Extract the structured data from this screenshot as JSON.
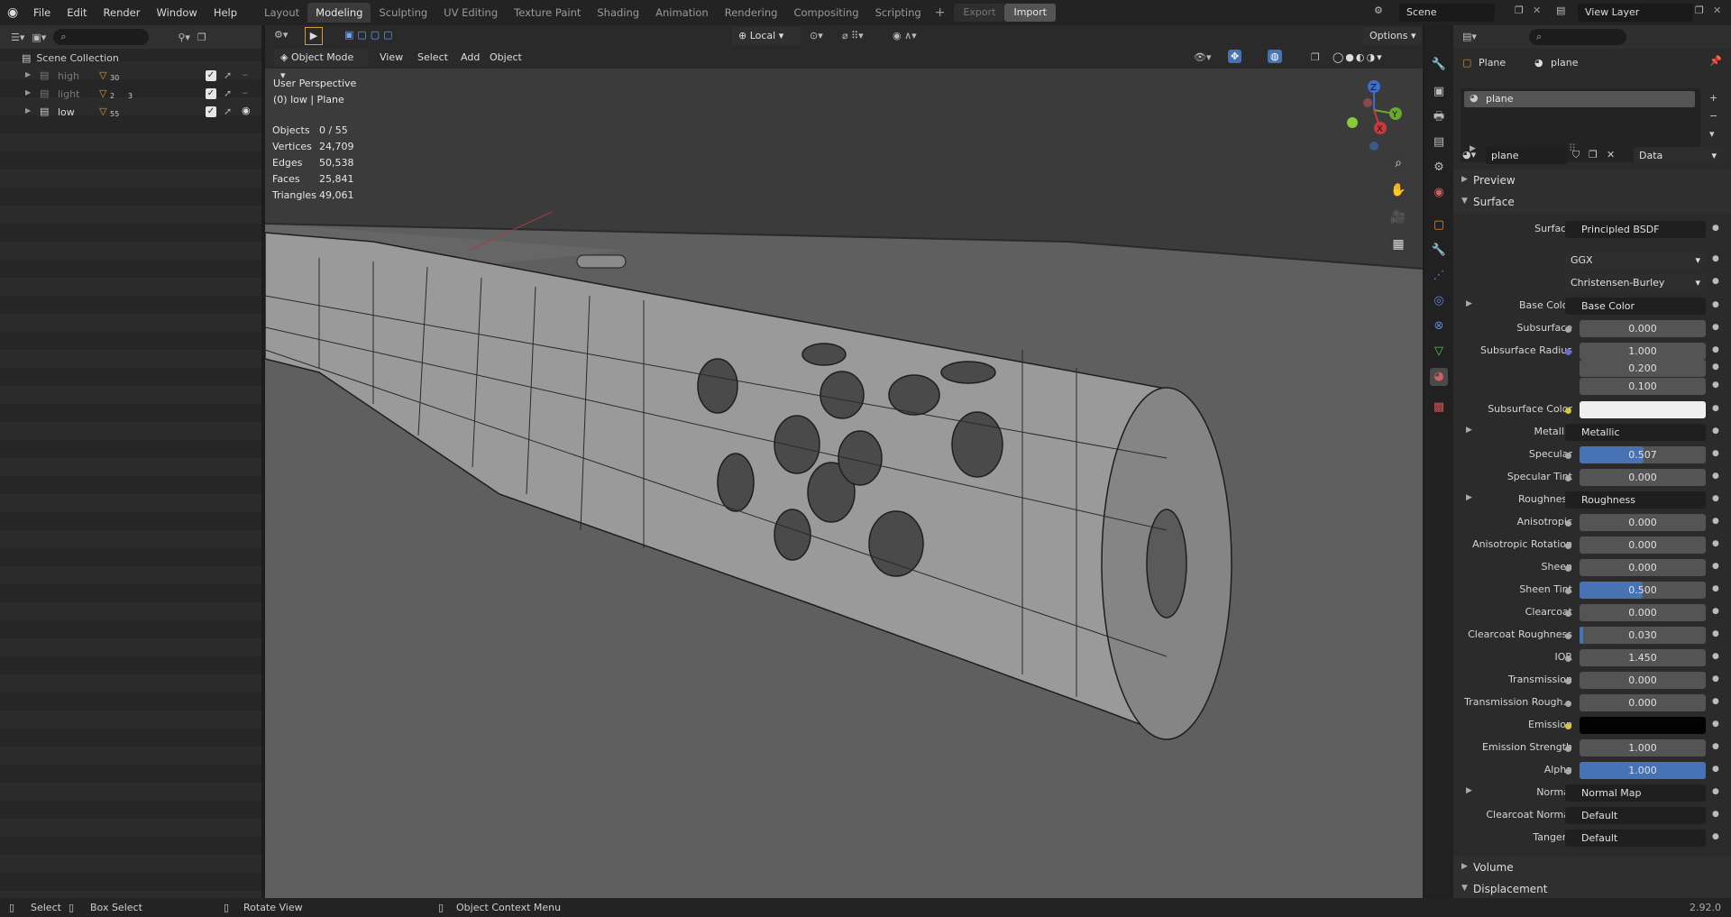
{
  "topbar": {
    "menu": [
      "File",
      "Edit",
      "Render",
      "Window",
      "Help"
    ],
    "workspaces": [
      "Layout",
      "Modeling",
      "Sculpting",
      "UV Editing",
      "Texture Paint",
      "Shading",
      "Animation",
      "Rendering",
      "Compositing",
      "Scripting"
    ],
    "active_workspace": "Modeling",
    "export_label": "Export",
    "import_label": "Import",
    "scene": "Scene",
    "view_layer": "View Layer"
  },
  "outliner": {
    "collection": "Scene Collection",
    "items": [
      {
        "name": "high",
        "count": "30",
        "dim": true
      },
      {
        "name": "light",
        "count": "2",
        "count2": "3",
        "dim": true
      },
      {
        "name": "low",
        "count": "55",
        "dim": false
      }
    ]
  },
  "viewport": {
    "mode": "Object Mode",
    "menus": [
      "View",
      "Select",
      "Add",
      "Object"
    ],
    "transform": "Local",
    "options": "Options",
    "perspective": "User Perspective",
    "object_info": "(0) low | Plane",
    "stats": [
      {
        "k": "Objects",
        "v": "0 / 55"
      },
      {
        "k": "Vertices",
        "v": "24,709"
      },
      {
        "k": "Edges",
        "v": "50,538"
      },
      {
        "k": "Faces",
        "v": "25,841"
      },
      {
        "k": "Triangles",
        "v": "49,061"
      }
    ],
    "gizmo": {
      "x": "X",
      "y": "Y",
      "z": "Z"
    }
  },
  "properties": {
    "object": "Plane",
    "material": "plane",
    "slot": "plane",
    "material_field": "plane",
    "link": "Data",
    "preview": "Preview",
    "surface_section": "Surface",
    "volume": "Volume",
    "displacement": "Displacement",
    "rows": [
      {
        "label": "Surface",
        "value": "Principled BSDF",
        "kind": "txt",
        "dot": "#43b34a"
      },
      {
        "label": "",
        "value": "GGX",
        "kind": "sel"
      },
      {
        "label": "",
        "value": "Christensen-Burley",
        "kind": "sel"
      },
      {
        "label": "Base Color",
        "value": "Base Color",
        "kind": "txt",
        "dot": "#d7c33e",
        "tri": true
      },
      {
        "label": "Subsurface",
        "value": "0.000"
      },
      {
        "label": "Subsurface Radius",
        "value": "1.000",
        "dot": "#6a6ad0"
      },
      {
        "label": "",
        "value": "0.200"
      },
      {
        "label": "",
        "value": "0.100"
      },
      {
        "label": "Subsurface Color",
        "value": "",
        "kind": "white",
        "dot": "#d7c33e"
      },
      {
        "label": "Metallic",
        "value": "Metallic",
        "kind": "txt",
        "tri": true
      },
      {
        "label": "Specular",
        "value": "0.507",
        "fill": 0.507
      },
      {
        "label": "Specular Tint",
        "value": "0.000"
      },
      {
        "label": "Roughness",
        "value": "Roughness",
        "kind": "txt",
        "tri": true
      },
      {
        "label": "Anisotropic",
        "value": "0.000"
      },
      {
        "label": "Anisotropic Rotation",
        "value": "0.000"
      },
      {
        "label": "Sheen",
        "value": "0.000"
      },
      {
        "label": "Sheen Tint",
        "value": "0.500",
        "fill": 0.5
      },
      {
        "label": "Clearcoat",
        "value": "0.000"
      },
      {
        "label": "Clearcoat Roughness",
        "value": "0.030",
        "fill": 0.03
      },
      {
        "label": "IOR",
        "value": "1.450"
      },
      {
        "label": "Transmission",
        "value": "0.000"
      },
      {
        "label": "Transmission Rough...",
        "value": "0.000"
      },
      {
        "label": "Emission",
        "value": "",
        "kind": "black",
        "dot": "#d7c33e"
      },
      {
        "label": "Emission Strength",
        "value": "1.000"
      },
      {
        "label": "Alpha",
        "value": "1.000",
        "fill": 1.0
      },
      {
        "label": "Normal",
        "value": "Normal Map",
        "kind": "txt",
        "dot": "#6a6ad0",
        "tri": true
      },
      {
        "label": "Clearcoat Normal",
        "value": "Default",
        "kind": "txt",
        "dot": "#6a6ad0"
      },
      {
        "label": "Tangent",
        "value": "Default",
        "kind": "txt",
        "dot": "#6a6ad0"
      }
    ]
  },
  "status": {
    "select": "Select",
    "box_select": "Box Select",
    "rotate": "Rotate View",
    "context": "Object Context Menu",
    "version": "2.92.0"
  }
}
